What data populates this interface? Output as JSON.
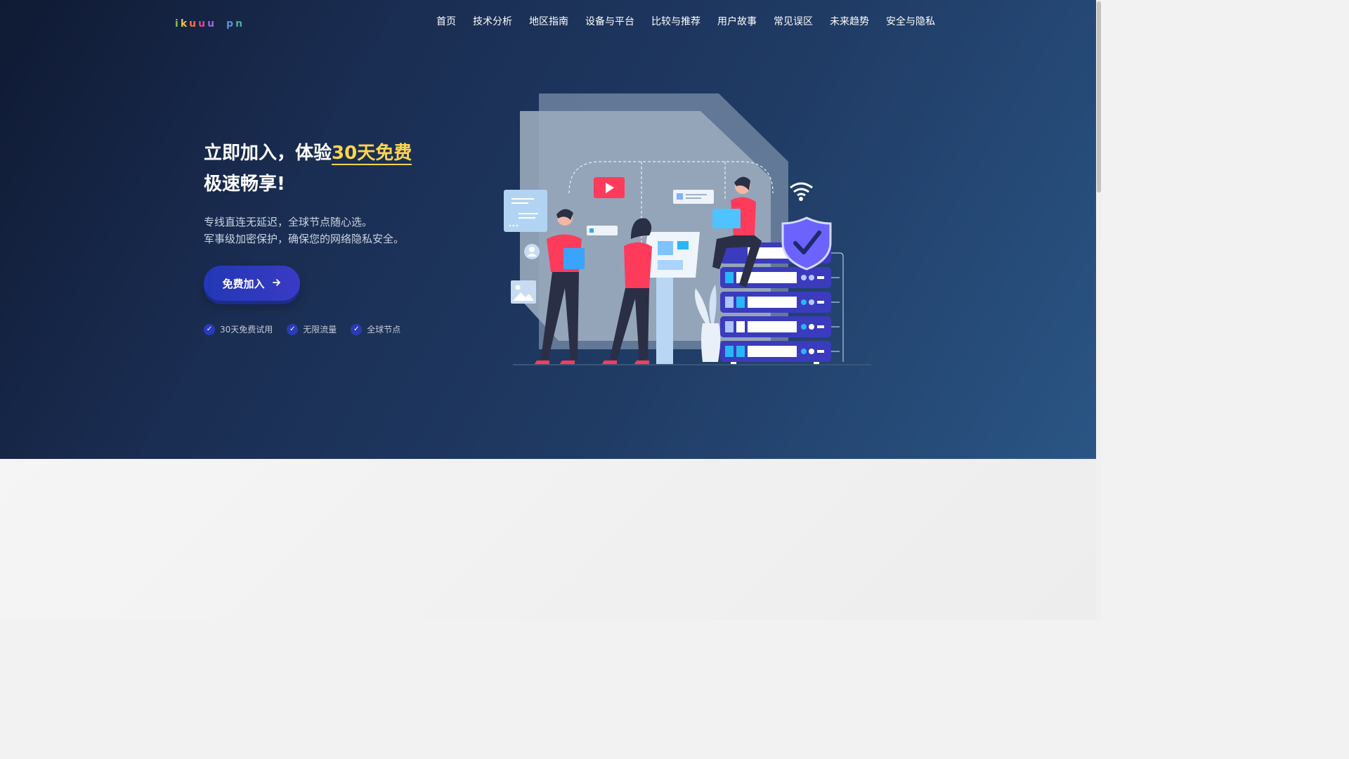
{
  "brand": {
    "logo_letters": [
      {
        "char": "i",
        "color": "#8bc34a"
      },
      {
        "char": "k",
        "color": "#f0c33c"
      },
      {
        "char": "u",
        "color": "#ff7043"
      },
      {
        "char": "u",
        "color": "#e84393"
      },
      {
        "char": "u",
        "color": "#9c6ade"
      },
      {
        "char": "p",
        "color": "#5e8fd6"
      },
      {
        "char": "n",
        "color": "#4caf9b"
      }
    ]
  },
  "nav": {
    "items": [
      "首页",
      "技术分析",
      "地区指南",
      "设备与平台",
      "比较与推荐",
      "用户故事",
      "常见误区",
      "未来趋势",
      "安全与隐私"
    ]
  },
  "hero": {
    "headline_line1": "立即加入，体验",
    "headline_highlight": "30天免费",
    "headline_line2": "极速畅享!",
    "sub_line1": "专线直连无延迟，全球节点随心选。",
    "sub_line2": "军事级加密保护，确保您的网络隐私安全。",
    "cta_label": "免费加入",
    "cta_icon": "arrow-right-icon",
    "features": [
      "30天免费试用",
      "无限流量",
      "全球节点"
    ],
    "feature_icon": "check-circle-icon"
  },
  "colors": {
    "hero_bg_start": "#0f1a33",
    "hero_bg_end": "#2a5584",
    "highlight": "#ffd54f",
    "cta": "#2a3bb8",
    "accent_red": "#ff3b5c",
    "server_purple": "#3b3bbd"
  }
}
